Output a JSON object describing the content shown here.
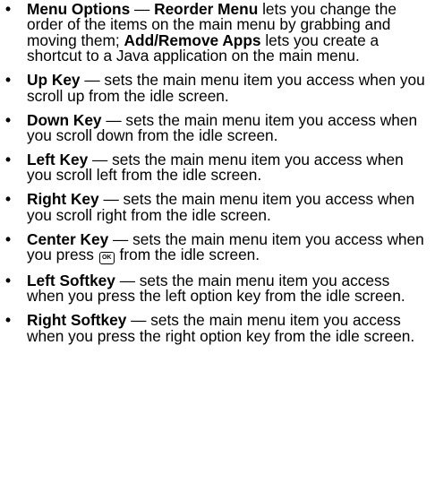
{
  "items": [
    {
      "term": "Menu Options",
      "dash": " — ",
      "term2": "Reorder Menu",
      "text": " lets you change the order of the items on the main menu by grabbing and moving them; ",
      "term3": "Add/Remove Apps",
      "text2": " lets you create a shortcut to a Java application on the main menu."
    },
    {
      "term": "Up Key",
      "text": " — sets the main menu item you access when you scroll up from the idle screen."
    },
    {
      "term": "Down Key",
      "text": " — sets the main menu item you access when you scroll down from the idle screen."
    },
    {
      "term": "Left Key",
      "text": " — sets the main menu item you access when you scroll left from the idle screen."
    },
    {
      "term": "Right Key",
      "text": " — sets the main menu item you access when you scroll right from the idle screen."
    },
    {
      "term": "Center Key",
      "text": " — sets the main menu item you access when you press ",
      "icon_label": "OK",
      "icon_name": "ok-key-icon",
      "text2": " from the idle screen."
    },
    {
      "term": "Left Softkey",
      "text": " — sets the main menu item you access when you press the left option key from the idle screen."
    },
    {
      "term": "Right Softkey",
      "text": " — sets the main menu item you access when you press the right option key from the idle screen."
    }
  ],
  "bullet_char": "•"
}
